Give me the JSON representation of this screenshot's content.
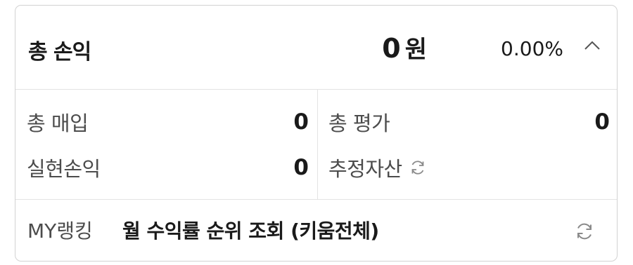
{
  "summary": {
    "title": "총 손익",
    "amount": "0",
    "unit": "원",
    "rate": "0.00%",
    "toggle_icon": "chevron-up-icon"
  },
  "details": {
    "buy_label": "총 매입",
    "buy_value": "0",
    "eval_label": "총 평가",
    "eval_value": "0",
    "realized_label": "실현손익",
    "realized_value": "0",
    "estimated_label": "추정자산",
    "estimated_icon": "refresh-icon"
  },
  "ranking": {
    "label": "MY랭킹",
    "link_text": "월 수익률 순위 조회 (키움전체)",
    "refresh_icon": "refresh-icon"
  },
  "colors": {
    "border": "#d2d2d2",
    "divider": "#e3e3e3",
    "text": "#1a1a1a",
    "label": "#4c4c4c",
    "icon": "#8a8a8a"
  }
}
